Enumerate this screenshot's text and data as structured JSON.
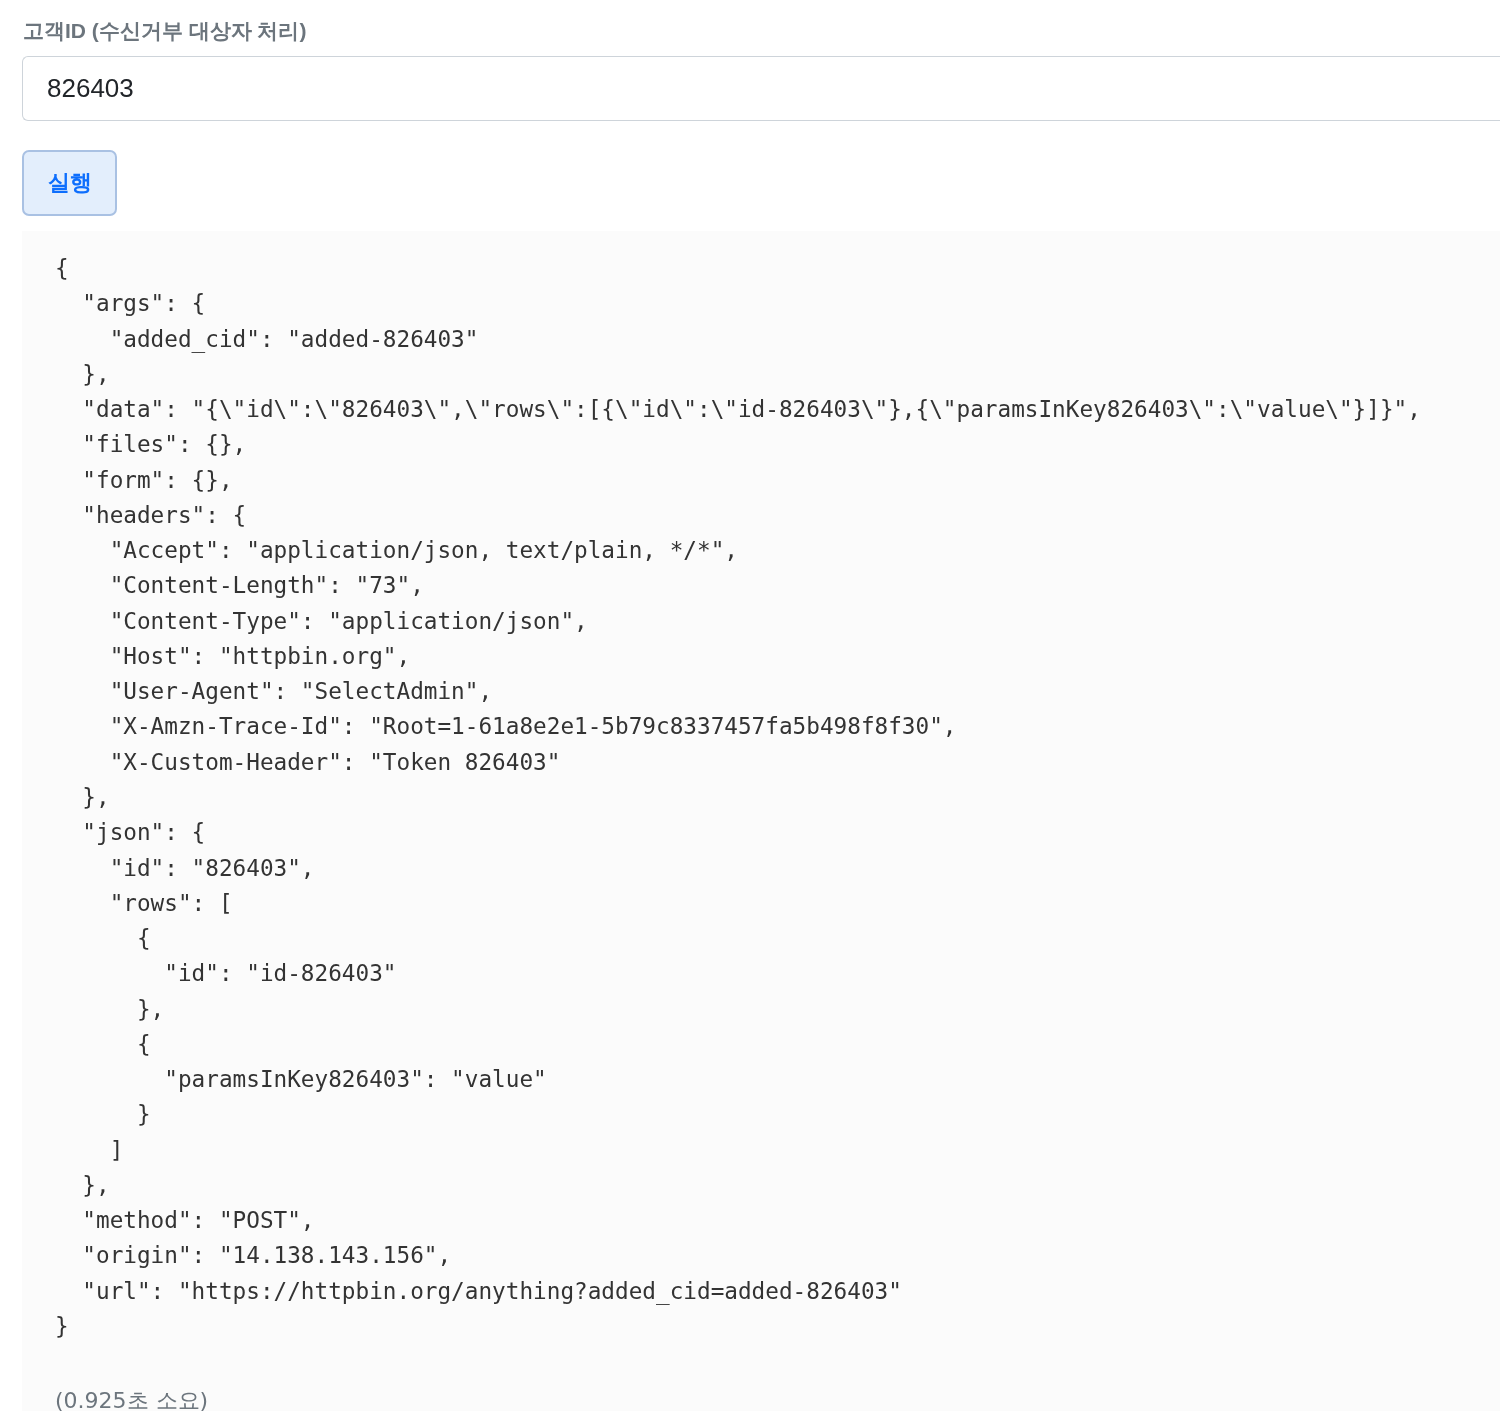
{
  "field": {
    "label": "고객ID (수신거부 대상자 처리)",
    "value": "826403"
  },
  "run_button": {
    "label": "실행"
  },
  "result": {
    "lines": [
      "{",
      "  \"args\": {",
      "    \"added_cid\": \"added-826403\"",
      "  },",
      "  \"data\": \"{\\\"id\\\":\\\"826403\\\",\\\"rows\\\":[{\\\"id\\\":\\\"id-826403\\\"},{\\\"paramsInKey826403\\\":\\\"value\\\"}]}\",",
      "  \"files\": {},",
      "  \"form\": {},",
      "  \"headers\": {",
      "    \"Accept\": \"application/json, text/plain, */*\",",
      "    \"Content-Length\": \"73\",",
      "    \"Content-Type\": \"application/json\",",
      "    \"Host\": \"httpbin.org\",",
      "    \"User-Agent\": \"SelectAdmin\",",
      "    \"X-Amzn-Trace-Id\": \"Root=1-61a8e2e1-5b79c8337457fa5b498f8f30\",",
      "    \"X-Custom-Header\": \"Token 826403\"",
      "  },",
      "  \"json\": {",
      "    \"id\": \"826403\",",
      "    \"rows\": [",
      "      {",
      "        \"id\": \"id-826403\"",
      "      },",
      "      {",
      "        \"paramsInKey826403\": \"value\"",
      "      }",
      "    ]",
      "  },",
      "  \"method\": \"POST\",",
      "  \"origin\": \"14.138.143.156\",",
      "  \"url\": \"https://httpbin.org/anything?added_cid=added-826403\"",
      "}"
    ],
    "elapsed": "(0.925초 소요)"
  }
}
